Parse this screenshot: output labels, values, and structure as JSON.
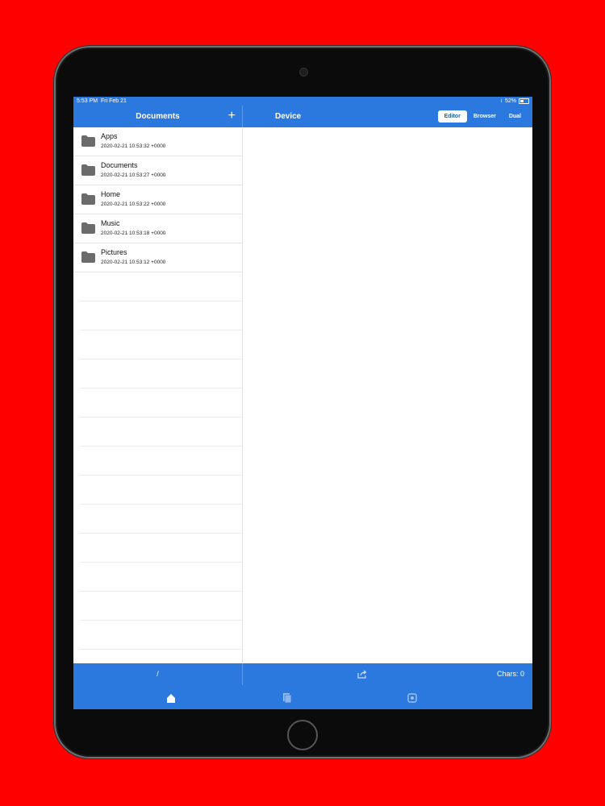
{
  "status_bar": {
    "time": "5:53 PM",
    "date": "Fri Feb 21",
    "battery": "52%"
  },
  "left_panel": {
    "title": "Documents",
    "add_symbol": "+"
  },
  "right_panel": {
    "title": "Device",
    "segments": [
      {
        "label": "Editor",
        "active": true
      },
      {
        "label": "Browser",
        "active": false
      },
      {
        "label": "Dual",
        "active": false
      }
    ]
  },
  "files": [
    {
      "name": "Apps",
      "date": "2020-02-21 10:53:32 +0000"
    },
    {
      "name": "Documents",
      "date": "2020-02-21 10:53:27 +0000"
    },
    {
      "name": "Home",
      "date": "2020-02-21 10:53:22 +0000"
    },
    {
      "name": "Music",
      "date": "2020-02-21 10:53:18 +0000"
    },
    {
      "name": "Pictures",
      "date": "2020-02-21 10:53:12 +0000"
    }
  ],
  "bottom_bar": {
    "path": "/",
    "chars": "Chars: 0"
  },
  "icons": {
    "folder": "folder-icon",
    "share": "share-icon",
    "tabs": [
      "home-icon",
      "documents-icon",
      "settings-icon"
    ]
  },
  "colors": {
    "background": "#fe0000",
    "accent": "#2b79de",
    "folder": "#6b6b6b"
  }
}
